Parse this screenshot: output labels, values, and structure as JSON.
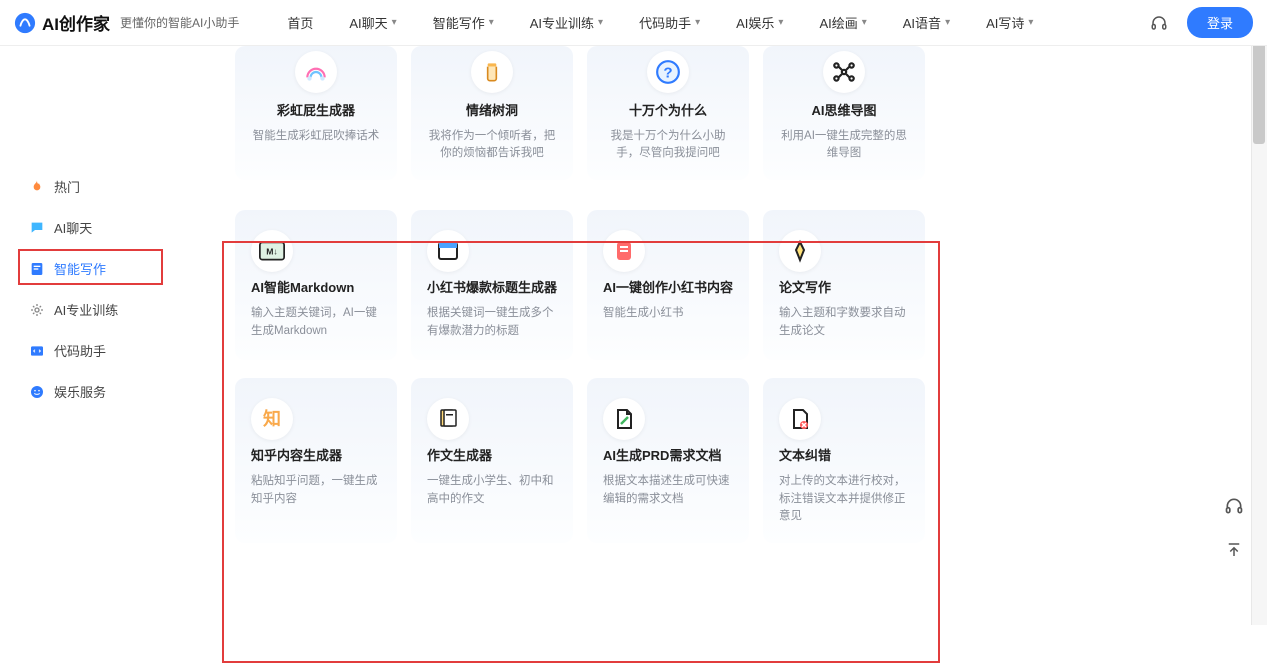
{
  "brand": {
    "title": "AI创作家",
    "subtitle": "更懂你的智能AI小助手"
  },
  "nav": {
    "items": [
      {
        "label": "首页",
        "dropdown": false
      },
      {
        "label": "AI聊天",
        "dropdown": true
      },
      {
        "label": "智能写作",
        "dropdown": true
      },
      {
        "label": "AI专业训练",
        "dropdown": true
      },
      {
        "label": "代码助手",
        "dropdown": true
      },
      {
        "label": "AI娱乐",
        "dropdown": true
      },
      {
        "label": "AI绘画",
        "dropdown": true
      },
      {
        "label": "AI语音",
        "dropdown": true
      },
      {
        "label": "AI写诗",
        "dropdown": true
      }
    ]
  },
  "header": {
    "login": "登录"
  },
  "sidebar": {
    "items": [
      {
        "label": "热门",
        "icon": "flame"
      },
      {
        "label": "AI聊天",
        "icon": "chat"
      },
      {
        "label": "智能写作",
        "icon": "doc",
        "active": true
      },
      {
        "label": "AI专业训练",
        "icon": "training"
      },
      {
        "label": "代码助手",
        "icon": "code"
      },
      {
        "label": "娱乐服务",
        "icon": "smile"
      }
    ]
  },
  "top_cards": [
    {
      "title": "彩虹屁生成器",
      "desc": "智能生成彩虹屁吹捧话术",
      "icon": "rainbow"
    },
    {
      "title": "情绪树洞",
      "desc": "我将作为一个倾听者，把你的烦恼都告诉我吧",
      "icon": "jar"
    },
    {
      "title": "十万个为什么",
      "desc": "我是十万个为什么小助手，尽管向我提问吧",
      "icon": "question"
    },
    {
      "title": "AI思维导图",
      "desc": "利用AI一键生成完整的思维导图",
      "icon": "mindmap"
    }
  ],
  "writing_cards": [
    {
      "title": "AI智能Markdown",
      "desc": "输入主题关键词，AI一键生成Markdown",
      "icon": "markdown"
    },
    {
      "title": "小红书爆款标题生成器",
      "desc": "根据关键词一键生成多个有爆款潜力的标题",
      "icon": "window"
    },
    {
      "title": "AI一键创作小红书内容",
      "desc": "智能生成小红书",
      "icon": "note"
    },
    {
      "title": "论文写作",
      "desc": "输入主题和字数要求自动生成论文",
      "icon": "pen"
    },
    {
      "title": "知乎内容生成器",
      "desc": "粘贴知乎问题，一键生成知乎内容",
      "icon": "zhi"
    },
    {
      "title": "作文生成器",
      "desc": "一键生成小学生、初中和高中的作文",
      "icon": "essay"
    },
    {
      "title": "AI生成PRD需求文档",
      "desc": "根据文本描述生成可快速编辑的需求文档",
      "icon": "prd"
    },
    {
      "title": "文本纠错",
      "desc": "对上传的文本进行校对，标注错误文本并提供修正意见",
      "icon": "correct"
    }
  ],
  "colors": {
    "accent": "#2f7bff",
    "highlight_border": "#e23c3c"
  }
}
